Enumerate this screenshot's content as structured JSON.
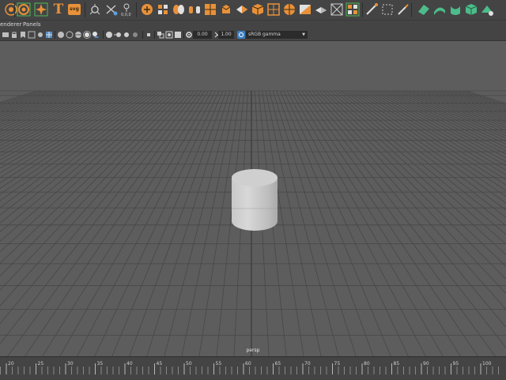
{
  "shelf": {
    "text_button_glyph": "T",
    "svg_button_glyph": "svg",
    "icons": [
      "sphere-icon",
      "torus-icon",
      "star-icon",
      "text-tool-icon",
      "svg-tool-icon",
      "joint-icon",
      "ik-handle-icon",
      "locator-icon",
      "camera-render-icon",
      "mesh-ops-icon"
    ]
  },
  "menu": {
    "renderer": "enderer",
    "panels": "Panels"
  },
  "panel_toolbar": {
    "exposure_value": "0.00",
    "gamma_value": "1.00",
    "color_space": "sRGB gamma"
  },
  "viewport": {
    "camera_name": "persp"
  },
  "timeline": {
    "tick_labels": [
      "20",
      "25",
      "30",
      "35",
      "40",
      "45",
      "50",
      "55",
      "60",
      "65",
      "70",
      "75",
      "80",
      "85",
      "90",
      "95",
      "100"
    ]
  }
}
